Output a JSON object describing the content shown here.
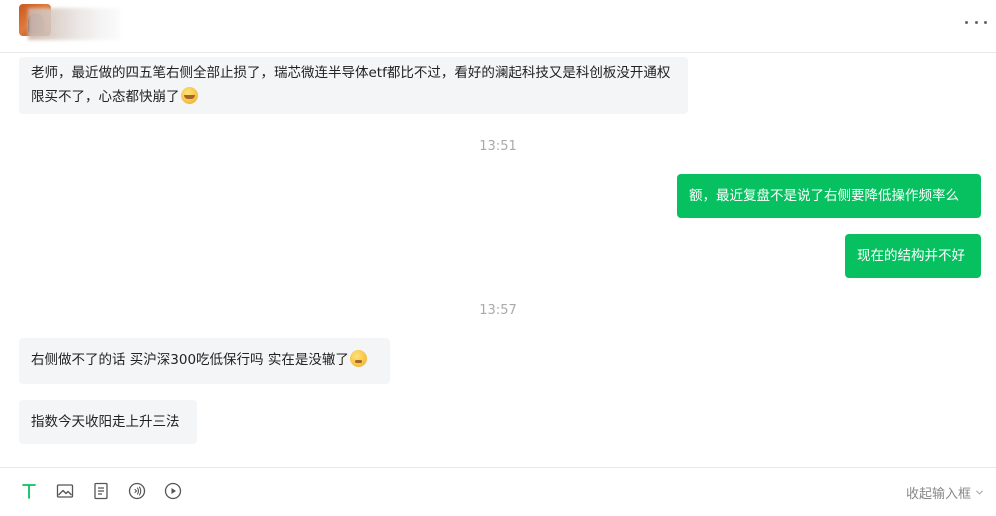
{
  "header": {
    "contact_name": "",
    "more_icon": "more-horizontal-icon"
  },
  "messages": [
    {
      "side": "in",
      "text": "老师，最近做的四五笔右侧全部止损了，瑞芯微连半导体etf都比不过，看好的澜起科技又是科创板没开通权限买不了，心态都快崩了",
      "emoji": "crying-laughing-emoji"
    },
    {
      "type": "time",
      "text": "13:51"
    },
    {
      "side": "out",
      "text": "额，最近复盘不是说了右侧要降低操作频率么"
    },
    {
      "side": "out",
      "text": "现在的结构并不好"
    },
    {
      "type": "time",
      "text": "13:57"
    },
    {
      "side": "in",
      "text": "右侧做不了的话 买沪深300吃低保行吗 实在是没辙了",
      "emoji": "worried-emoji"
    },
    {
      "side": "in",
      "text": "指数今天收阳走上升三法"
    }
  ],
  "toolbar": {
    "text_icon": "text-format-icon",
    "image_icon": "image-icon",
    "document_icon": "document-icon",
    "audio_icon": "audio-icon",
    "video_icon": "play-icon",
    "collapse_label": "收起输入框"
  },
  "colors": {
    "outgoing_bubble": "#07c160",
    "incoming_bubble": "#f4f5f7",
    "accent": "#07c160"
  }
}
